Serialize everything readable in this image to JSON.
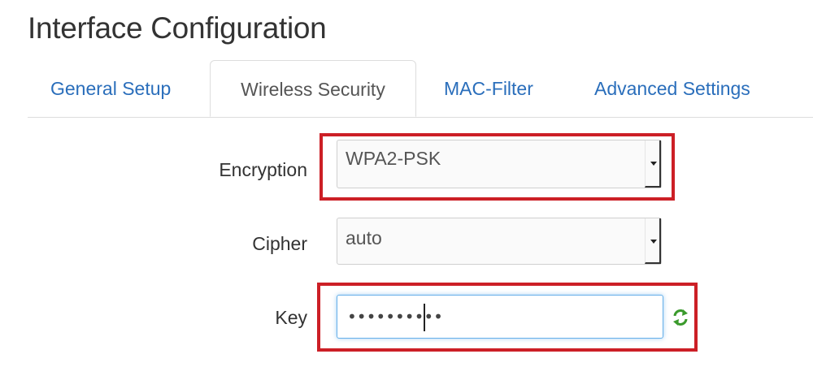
{
  "page": {
    "title": "Interface Configuration"
  },
  "tabs": [
    {
      "label": "General Setup",
      "active": false
    },
    {
      "label": "Wireless Security",
      "active": true
    },
    {
      "label": "MAC-Filter",
      "active": false
    },
    {
      "label": "Advanced Settings",
      "active": false
    }
  ],
  "form": {
    "encryption": {
      "label": "Encryption",
      "value": "WPA2-PSK"
    },
    "cipher": {
      "label": "Cipher",
      "value": "auto"
    },
    "key": {
      "label": "Key",
      "value": "••••••••••",
      "reveal_icon": "refresh-reveal-icon"
    }
  },
  "colors": {
    "highlight": "#cc1f26",
    "tab_link": "#2a6ebb",
    "focus_border": "#66afe9",
    "icon_green": "#3a9a2c"
  }
}
